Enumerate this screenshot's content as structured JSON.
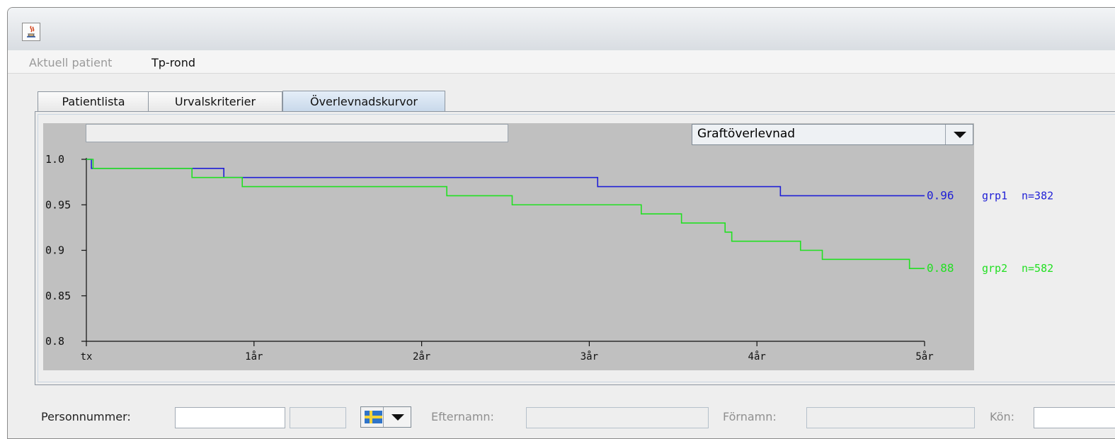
{
  "window": {
    "icon": "java-app-icon"
  },
  "menubar": {
    "items": [
      {
        "label": "Aktuell patient",
        "enabled": false
      },
      {
        "label": "Tp-rond",
        "enabled": true
      }
    ]
  },
  "tabs": [
    {
      "label": "Patientlista",
      "selected": false
    },
    {
      "label": "Urvalskriterier",
      "selected": false
    },
    {
      "label": "Överlevnadskurvor",
      "selected": true
    }
  ],
  "chart_controls": {
    "title_value": "",
    "curve_type": {
      "selected": "Graftöverlevnad",
      "icon": "chevron-down-icon"
    }
  },
  "chart_data": {
    "type": "line",
    "step": true,
    "ylim": [
      0.8,
      1.0
    ],
    "xlim": [
      0,
      5
    ],
    "yticks": [
      {
        "value": 1.0,
        "label": "1.0"
      },
      {
        "value": 0.95,
        "label": "0.95"
      },
      {
        "value": 0.9,
        "label": "0.9"
      },
      {
        "value": 0.85,
        "label": "0.85"
      },
      {
        "value": 0.8,
        "label": "0.8"
      }
    ],
    "xticks": [
      {
        "value": 0,
        "label": "tx"
      },
      {
        "value": 1,
        "label": "1år"
      },
      {
        "value": 2,
        "label": "2år"
      },
      {
        "value": 3,
        "label": "3år"
      },
      {
        "value": 4,
        "label": "4år"
      },
      {
        "value": 5,
        "label": "5år"
      }
    ],
    "series": [
      {
        "name": "grp1",
        "n_label": "n=382",
        "end_label": "0.96",
        "color": "#1f1fd6",
        "x": [
          0,
          0.01,
          0.03,
          0.63,
          0.81,
          0.82,
          3.04,
          3.05,
          4.13,
          4.14,
          5.0
        ],
        "y": [
          1.0,
          1.0,
          0.99,
          0.99,
          0.99,
          0.98,
          0.98,
          0.97,
          0.97,
          0.96,
          0.96
        ]
      },
      {
        "name": "grp2",
        "n_label": "n=582",
        "end_label": "0.88",
        "color": "#22e022",
        "x": [
          0,
          0.02,
          0.04,
          0.62,
          0.63,
          0.92,
          0.93,
          2.14,
          2.15,
          2.53,
          2.54,
          3.3,
          3.31,
          3.54,
          3.55,
          3.8,
          3.81,
          3.84,
          3.85,
          4.25,
          4.26,
          4.38,
          4.39,
          4.9,
          4.91,
          5.0
        ],
        "y": [
          1.0,
          1.0,
          0.99,
          0.99,
          0.98,
          0.98,
          0.97,
          0.97,
          0.96,
          0.96,
          0.95,
          0.95,
          0.94,
          0.94,
          0.93,
          0.93,
          0.92,
          0.92,
          0.91,
          0.91,
          0.9,
          0.9,
          0.89,
          0.89,
          0.88,
          0.88
        ]
      }
    ]
  },
  "search": {
    "personnummer_label": "Personnummer:",
    "personnummer_value": "",
    "personnummer_suffix_value": "",
    "country_flag_icon": "sweden-flag-icon",
    "efternamn_label": "Efternamn:",
    "efternamn_value": "",
    "fornamn_label": "Förnamn:",
    "fornamn_value": "",
    "kon_label": "Kön:",
    "kon_value": ""
  }
}
